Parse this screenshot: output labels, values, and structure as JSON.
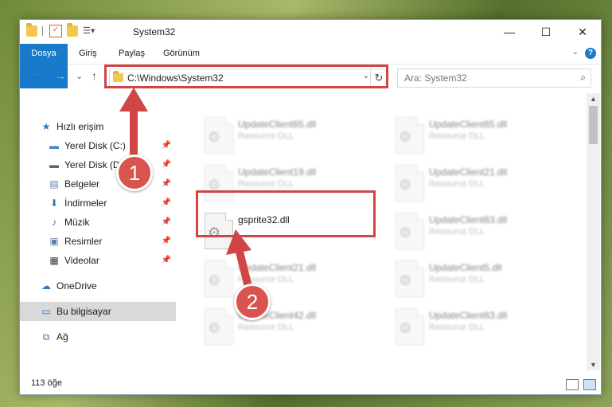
{
  "window": {
    "title": "System32",
    "controls": {
      "minimize": "—",
      "maximize": "☐",
      "close": "✕"
    }
  },
  "ribbon": {
    "tabs": [
      "Dosya",
      "Giriş",
      "Paylaş",
      "Görünüm"
    ],
    "help": "?"
  },
  "navigation": {
    "back": "←",
    "forward": "→",
    "recent": "⌄",
    "up": "↑",
    "address": "C:\\Windows\\System32",
    "search_placeholder": "Ara: System32"
  },
  "sidebar": {
    "items": [
      {
        "label": "Hızlı erişim",
        "icon": "star-icon",
        "glyph": "★",
        "color": "#2b78c5",
        "pinned": false
      },
      {
        "label": "Yerel Disk (C:)",
        "icon": "drive-windows-icon",
        "glyph": "▬",
        "color": "#4a86c8",
        "pinned": true
      },
      {
        "label": "Yerel Disk (D:)",
        "icon": "drive-icon",
        "glyph": "▬",
        "color": "#666666",
        "pinned": true
      },
      {
        "label": "Belgeler",
        "icon": "documents-icon",
        "glyph": "▤",
        "color": "#5a7fa8",
        "pinned": true
      },
      {
        "label": "İndirmeler",
        "icon": "download-icon",
        "glyph": "⬇",
        "color": "#2b78c5",
        "pinned": true
      },
      {
        "label": "Müzik",
        "icon": "music-icon",
        "glyph": "♪",
        "color": "#2b78c5",
        "pinned": true
      },
      {
        "label": "Resimler",
        "icon": "pictures-icon",
        "glyph": "▣",
        "color": "#5a7fa8",
        "pinned": true
      },
      {
        "label": "Videolar",
        "icon": "videos-icon",
        "glyph": "▦",
        "color": "#333333",
        "pinned": true
      },
      {
        "label": "OneDrive",
        "icon": "onedrive-icon",
        "glyph": "☁",
        "color": "#2b78c5",
        "pinned": false
      },
      {
        "label": "Bu bilgisayar",
        "icon": "computer-icon",
        "glyph": "▭",
        "color": "#2b78c5",
        "pinned": false
      },
      {
        "label": "Ağ",
        "icon": "network-icon",
        "glyph": "⧉",
        "color": "#2b78c5",
        "pinned": false
      }
    ],
    "pin_glyph": "📌"
  },
  "files": [
    {
      "name": "UpdateClient65.dll",
      "type": "Resource DLL",
      "blurred": true
    },
    {
      "name": "UpdateClient65.dll",
      "type": "Resource DLL",
      "blurred": true
    },
    {
      "name": "UpdateClient19.dll",
      "type": "Resource DLL",
      "blurred": true
    },
    {
      "name": "UpdateClient21.dll",
      "type": "Resource DLL",
      "blurred": true
    },
    {
      "name": "gsprite32.dll",
      "type": "",
      "blurred": false
    },
    {
      "name": "UpdateClient63.dll",
      "type": "Resource DLL",
      "blurred": true
    },
    {
      "name": "UpdateClient21.dll",
      "type": "Resource DLL",
      "blurred": true
    },
    {
      "name": "UpdateClient5.dll",
      "type": "Resource DLL",
      "blurred": true
    },
    {
      "name": "UpdateClient42.dll",
      "type": "Resource DLL",
      "blurred": true
    },
    {
      "name": "UpdateClient63.dll",
      "type": "Resource DLL",
      "blurred": true
    }
  ],
  "status": {
    "item_count": "113 öğe"
  },
  "annotations": {
    "step1": "1",
    "step2": "2",
    "color": "#d04545"
  }
}
